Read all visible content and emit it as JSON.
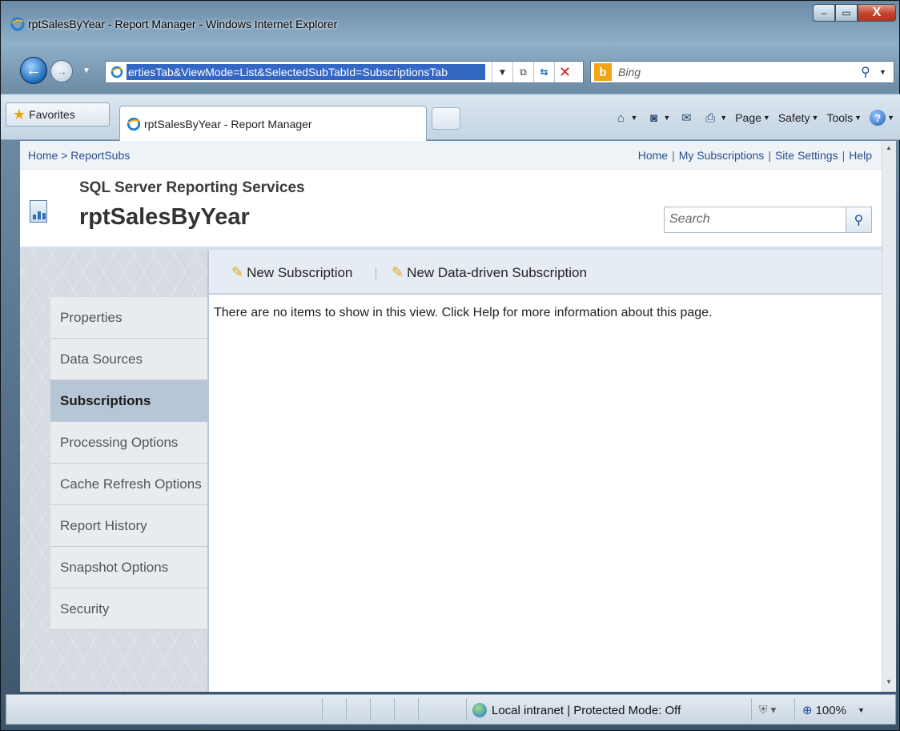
{
  "window": {
    "title": "rptSalesByYear - Report Manager - Windows Internet Explorer",
    "min_label": "–",
    "max_label": "▭",
    "close_label": "X"
  },
  "address_bar": {
    "url": "ertiesTab&ViewMode=List&SelectedSubTabId=SubscriptionsTab",
    "compat_icon": "compatibility-icon",
    "refresh_icon": "refresh-icon",
    "stop_label": "✕"
  },
  "search_bar": {
    "brand": "Bing"
  },
  "favorites_bar": {
    "favorites_label": "Favorites",
    "tab_title": "rptSalesByYear - Report Manager"
  },
  "command_bar": {
    "page_label": "Page",
    "safety_label": "Safety",
    "tools_label": "Tools"
  },
  "report_manager": {
    "breadcrumb": "Home > ReportSubs",
    "links": [
      "Home",
      "My Subscriptions",
      "Site Settings",
      "Help"
    ],
    "app_name": "SQL Server Reporting Services",
    "report_name": "rptSalesByYear",
    "search_placeholder": "Search",
    "nav_items": [
      {
        "label": "Properties",
        "active": false
      },
      {
        "label": "Data Sources",
        "active": false
      },
      {
        "label": "Subscriptions",
        "active": true
      },
      {
        "label": "Processing Options",
        "active": false
      },
      {
        "label": "Cache Refresh Options",
        "active": false
      },
      {
        "label": "Report History",
        "active": false
      },
      {
        "label": "Snapshot Options",
        "active": false
      },
      {
        "label": "Security",
        "active": false
      }
    ],
    "actions": {
      "new_subscription": "New Subscription",
      "new_data_driven": "New Data-driven Subscription"
    },
    "empty_message": "There are no items to show in this view. Click Help for more information about this page."
  },
  "status_bar": {
    "zone": "Local intranet | Protected Mode: Off",
    "zoom": "100%"
  }
}
